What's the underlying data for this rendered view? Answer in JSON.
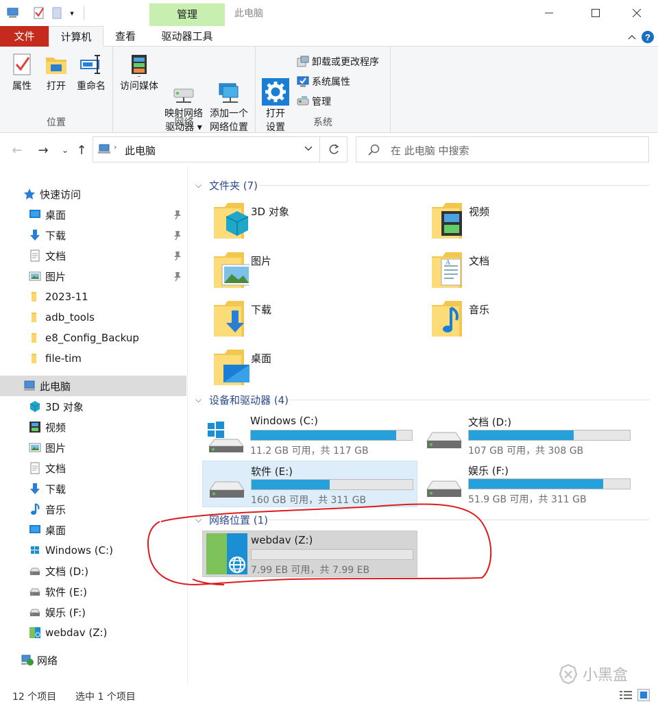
{
  "window": {
    "title": "此电脑",
    "contextual_tab": "管理",
    "controls": {
      "minimize": "—",
      "maximize": "☐",
      "close": "✕"
    }
  },
  "ribbon_tabs": [
    "文件",
    "计算机",
    "查看",
    "驱动器工具"
  ],
  "ribbon": {
    "groups": [
      {
        "label": "位置",
        "buttons": [
          "属性",
          "打开",
          "重命名"
        ]
      },
      {
        "label": "网络",
        "buttons": [
          "访问媒体",
          "映射网络\n驱动器 ▾",
          "添加一个\n网络位置"
        ]
      },
      {
        "label": "系统",
        "buttons": [
          "打开\n设置"
        ],
        "small": [
          "卸载或更改程序",
          "系统属性",
          "管理"
        ]
      }
    ]
  },
  "address": {
    "path": "此电脑",
    "search_placeholder": "在 此电脑 中搜索"
  },
  "nav": {
    "quick_access": "快速访问",
    "quick_items": [
      {
        "label": "桌面",
        "icon": "desktop-icon",
        "pinned": true
      },
      {
        "label": "下载",
        "icon": "download-icon",
        "pinned": true
      },
      {
        "label": "文档",
        "icon": "document-icon",
        "pinned": true
      },
      {
        "label": "图片",
        "icon": "picture-icon",
        "pinned": true
      },
      {
        "label": "2023-11",
        "icon": "folder-icon"
      },
      {
        "label": "adb_tools",
        "icon": "folder-icon"
      },
      {
        "label": "e8_Config_Backup",
        "icon": "folder-icon"
      },
      {
        "label": "file-tim",
        "icon": "folder-icon"
      }
    ],
    "this_pc": "此电脑",
    "pc_items": [
      {
        "label": "3D 对象",
        "icon": "3d-objects-icon"
      },
      {
        "label": "视频",
        "icon": "video-icon"
      },
      {
        "label": "图片",
        "icon": "picture-icon"
      },
      {
        "label": "文档",
        "icon": "document-icon"
      },
      {
        "label": "下载",
        "icon": "download-icon"
      },
      {
        "label": "音乐",
        "icon": "music-icon"
      },
      {
        "label": "桌面",
        "icon": "desktop-icon"
      },
      {
        "label": "Windows (C:)",
        "icon": "windows-drive-icon"
      },
      {
        "label": "文档 (D:)",
        "icon": "drive-icon"
      },
      {
        "label": "软件 (E:)",
        "icon": "drive-icon"
      },
      {
        "label": "娱乐 (F:)",
        "icon": "drive-icon"
      },
      {
        "label": "webdav (Z:)",
        "icon": "network-drive-icon"
      }
    ],
    "network": "网络"
  },
  "content": {
    "folders_header": "文件夹 (7)",
    "folders": [
      "3D 对象",
      "视频",
      "图片",
      "文档",
      "下载",
      "音乐",
      "桌面"
    ],
    "drives_header": "设备和驱动器 (4)",
    "drives": [
      {
        "name": "Windows (C:)",
        "sub": "11.2 GB 可用，共 117 GB",
        "used": 0.904
      },
      {
        "name": "文档 (D:)",
        "sub": "107 GB 可用，共 308 GB",
        "used": 0.653
      },
      {
        "name": "软件 (E:)",
        "sub": "160 GB 可用，共 311 GB",
        "used": 0.486
      },
      {
        "name": "娱乐 (F:)",
        "sub": "51.9 GB 可用，共 311 GB",
        "used": 0.833
      }
    ],
    "network_header": "网络位置 (1)",
    "network_drive": {
      "name": "webdav (Z:)",
      "sub": "7.99 EB 可用，共 7.99 EB",
      "used": 0.0
    }
  },
  "status": {
    "count": "12 个项目",
    "selected": "选中 1 个项目"
  },
  "watermark": "小黑盒",
  "colors": {
    "accent": "#26a0da",
    "file_tab": "#c42b1c",
    "manage_tab": "#c7f0b0",
    "annotation": "#e0191c"
  }
}
